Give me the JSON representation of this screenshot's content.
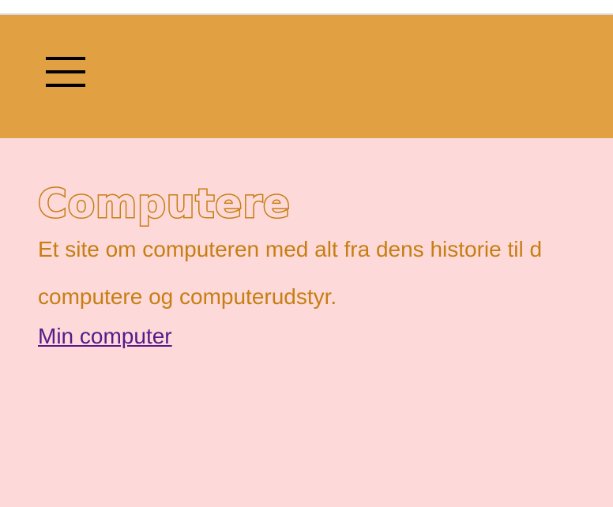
{
  "header": {
    "background": "#e1a041",
    "menu_icon": "hamburger-menu-icon"
  },
  "main": {
    "title": "Computere",
    "intro_line_1": "Et site om computeren med alt fra dens historie til d",
    "intro_line_2": "computere og computerudstyr.",
    "link_label": "Min computer"
  },
  "colors": {
    "page_background": "#fdd9d9",
    "text_accent": "#c77e12",
    "link": "#551a8b"
  }
}
